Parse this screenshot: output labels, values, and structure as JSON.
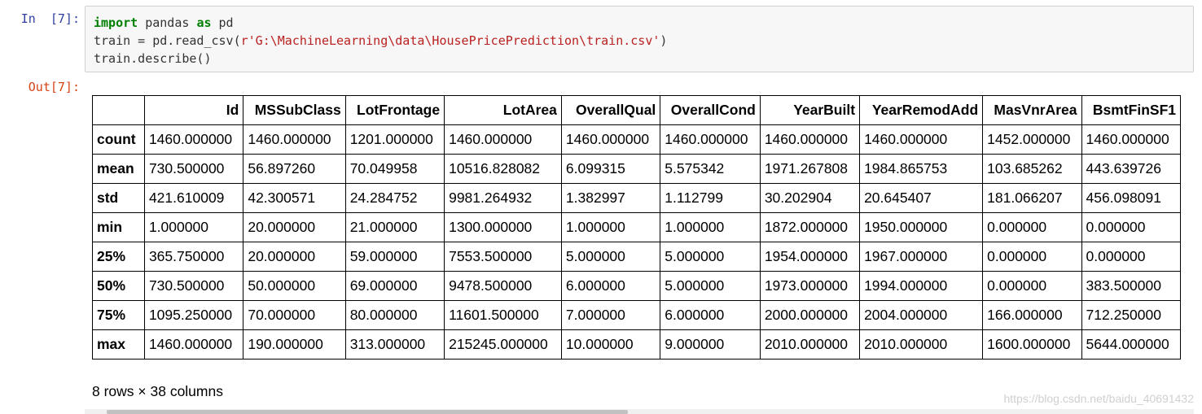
{
  "input_cell": {
    "prompt": "In  [7]:",
    "code": {
      "line1_kw1": "import",
      "line1_mid": " pandas ",
      "line1_kw2": "as",
      "line1_end": " pd",
      "line2_pre": "train = pd.read_csv(",
      "line2_str": "r'G:\\MachineLearning\\data\\HousePricePrediction\\train.csv'",
      "line2_post": ")",
      "line3": "train.describe()"
    }
  },
  "output_cell": {
    "prompt": "Out[7]:",
    "table": {
      "columns": [
        "",
        "Id",
        "MSSubClass",
        "LotFrontage",
        "LotArea",
        "OverallQual",
        "OverallCond",
        "YearBuilt",
        "YearRemodAdd",
        "MasVnrArea",
        "BsmtFinSF1"
      ],
      "rows": [
        {
          "label": "count",
          "values": [
            "1460.000000",
            "1460.000000",
            "1201.000000",
            "1460.000000",
            "1460.000000",
            "1460.000000",
            "1460.000000",
            "1460.000000",
            "1452.000000",
            "1460.000000"
          ]
        },
        {
          "label": "mean",
          "values": [
            "730.500000",
            "56.897260",
            "70.049958",
            "10516.828082",
            "6.099315",
            "5.575342",
            "1971.267808",
            "1984.865753",
            "103.685262",
            "443.639726"
          ]
        },
        {
          "label": "std",
          "values": [
            "421.610009",
            "42.300571",
            "24.284752",
            "9981.264932",
            "1.382997",
            "1.112799",
            "30.202904",
            "20.645407",
            "181.066207",
            "456.098091"
          ]
        },
        {
          "label": "min",
          "values": [
            "1.000000",
            "20.000000",
            "21.000000",
            "1300.000000",
            "1.000000",
            "1.000000",
            "1872.000000",
            "1950.000000",
            "0.000000",
            "0.000000"
          ]
        },
        {
          "label": "25%",
          "values": [
            "365.750000",
            "20.000000",
            "59.000000",
            "7553.500000",
            "5.000000",
            "5.000000",
            "1954.000000",
            "1967.000000",
            "0.000000",
            "0.000000"
          ]
        },
        {
          "label": "50%",
          "values": [
            "730.500000",
            "50.000000",
            "69.000000",
            "9478.500000",
            "6.000000",
            "5.000000",
            "1973.000000",
            "1994.000000",
            "0.000000",
            "383.500000"
          ]
        },
        {
          "label": "75%",
          "values": [
            "1095.250000",
            "70.000000",
            "80.000000",
            "11601.500000",
            "7.000000",
            "6.000000",
            "2000.000000",
            "2004.000000",
            "166.000000",
            "712.250000"
          ]
        },
        {
          "label": "max",
          "values": [
            "1460.000000",
            "190.000000",
            "313.000000",
            "215245.000000",
            "10.000000",
            "9.000000",
            "2010.000000",
            "2010.000000",
            "1600.000000",
            "5644.000000"
          ]
        }
      ]
    },
    "shape_text": "8 rows × 38 columns"
  },
  "scrollbar": {
    "position": 0.02,
    "visible_fraction": 0.47
  },
  "watermark": "https://blog.csdn.net/baidu_40691432"
}
